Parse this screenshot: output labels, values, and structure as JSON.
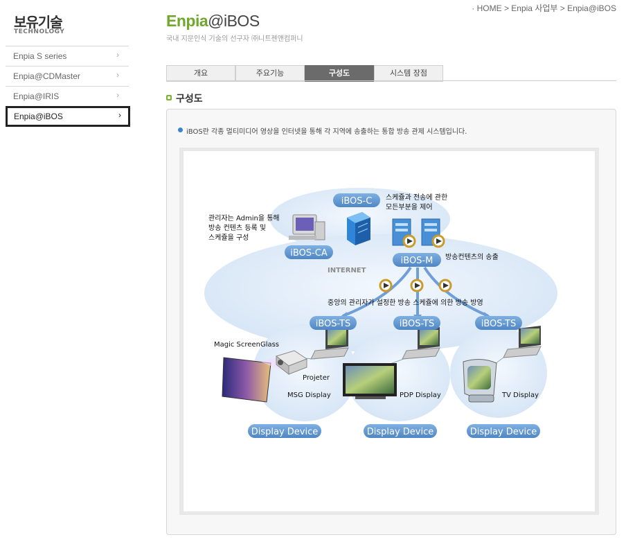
{
  "sidebar": {
    "title": "보유기술",
    "subtitle": "TECHNOLOGY",
    "items": [
      {
        "label": "Enpia S series",
        "active": false
      },
      {
        "label": "Enpia@CDMaster",
        "active": false
      },
      {
        "label": "Enpia@IRIS",
        "active": false
      },
      {
        "label": "Enpia@iBOS",
        "active": true
      }
    ]
  },
  "header": {
    "brand_green": "Enpia",
    "brand_dark": "@iBOS",
    "tagline": "국내 지문인식 기술의 선구자 ㈜니트젠앤컴퍼니",
    "breadcrumb": "· HOME > Enpia 사업부 > Enpia@iBOS"
  },
  "tabs": [
    {
      "label": "개요",
      "active": false
    },
    {
      "label": "주요기능",
      "active": false
    },
    {
      "label": "구성도",
      "active": true
    },
    {
      "label": "시스템 장점",
      "active": false
    }
  ],
  "section": {
    "title": "구성도",
    "description": "iBOS란 각종 멀티미디어 영상을 인터넷을 통해 각 지역에 송출하는 통합 방송 관제 시스템입니다."
  },
  "diagram": {
    "nodes": {
      "ibos_c": "iBOS-C",
      "ibos_ca": "iBOS-CA",
      "ibos_m": "iBOS-M",
      "ts1": "iBOS-TS",
      "ts2": "iBOS-TS",
      "ts3": "iBOS-TS"
    },
    "labels": {
      "internet": "INTERNET",
      "c_line1": "스케쥴과 전송에 관한",
      "c_line2": "모든부분을 제어",
      "admin_line1": "관리자는 Admin을 통해",
      "admin_line2": "방송 컨텐츠 등록 및",
      "admin_line3": "스케쥴을 구성",
      "m_label": "방송컨텐츠의 송출",
      "center_line": "중앙의 관리자가 설정한 방송 스케쥴에 의한 방송 방영",
      "magic": "Magic ScreenGlass",
      "projector": "Projeter",
      "msg": "MSG Display",
      "pdp": "PDP Display",
      "tv": "TV Display"
    },
    "devices": [
      "Display Device",
      "Display Device",
      "Display Device"
    ],
    "colors": {
      "node_blue": "#5b92cf",
      "cloud": "#dde9f7",
      "accent_green": "#6fa82c"
    }
  }
}
